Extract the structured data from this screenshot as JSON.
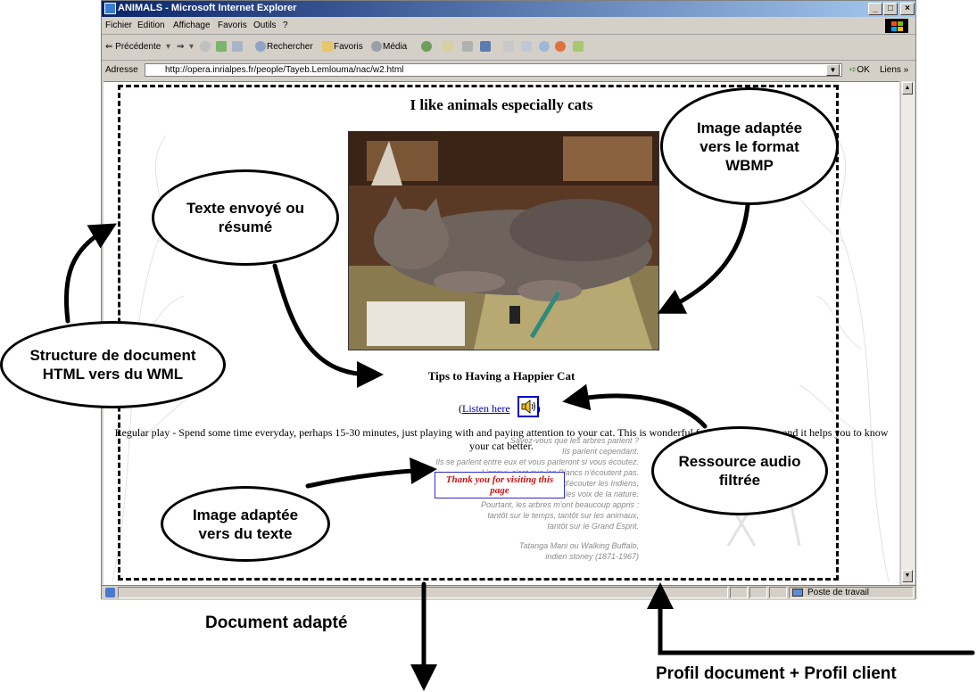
{
  "window": {
    "title": "ANIMALS - Microsoft Internet Explorer",
    "minimize": "_",
    "maximize": "□",
    "close": "×"
  },
  "menu": [
    "Fichier",
    "Edition",
    "Affichage",
    "Favoris",
    "Outils",
    "?"
  ],
  "toolbar": {
    "back": "⇐ Précédente",
    "forward": "⇒",
    "search": "Rechercher",
    "favorites": "Favoris",
    "media": "Média"
  },
  "address": {
    "label": "Adresse",
    "url": "http://opera.inrialpes.fr/people/Tayeb.Lemlouma/nac/w2.html",
    "go": "OK",
    "links": "Liens"
  },
  "status": {
    "zone": "Poste de travail"
  },
  "page": {
    "heading": "I like animals especially cats",
    "tips_title": "Tips to Having a Happier Cat",
    "listen_open": "(",
    "listen_link": "Listen here",
    "listen_close": ")",
    "paragraph": "Regular play - Spend some time everyday, perhaps 15-30 minutes, just playing with and paying attention to your cat. This is wonderful for the relationship, and it helps you to know your cat better.",
    "thanks_text": "Thank you for visiting this page",
    "quote_lines": [
      "Savez-vous que les arbres parlent ?",
      "Ils parlent cependant.",
      "Ils se parlent entre eux et vous parleront si vous écoutez.",
      "L'ennui, c'est que les Blancs n'écoutent pas.",
      "Ils n'ont jamais pris la peine d'écouter les Indiens,",
      "aussi ne pensent-ils pas écouter les voix de la nature.",
      "Pourtant, les arbres m'ont beaucoup appris :",
      "tantôt sur le temps, tantôt sur les animaux,",
      "tantôt sur le Grand Esprit.",
      "",
      "Tatanga Mani ou Walking Buffalo,",
      "indien stoney (1871-1967)"
    ]
  },
  "annotations": {
    "image_wbmp": "Image adaptée vers le format WBMP",
    "text_sent": "Texte envoyé ou résumé",
    "structure": "Structure de document HTML vers du WML",
    "audio": "Ressource audio filtrée",
    "image_text": "Image adaptée vers du texte",
    "doc_adapted": "Document adapté",
    "profiles": "Profil document + Profil client"
  }
}
